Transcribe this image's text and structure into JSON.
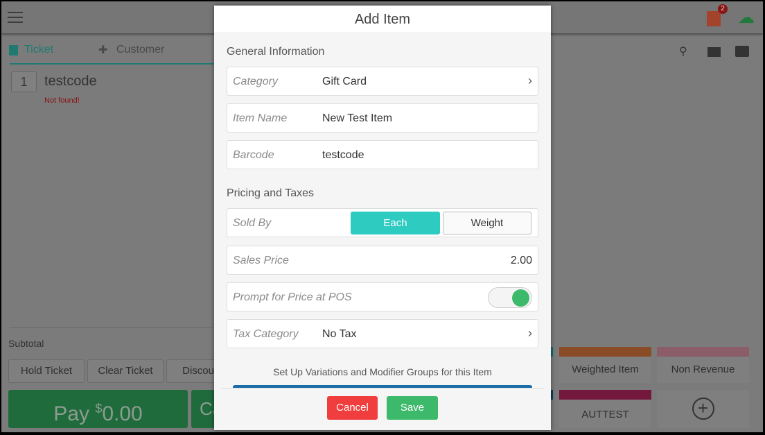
{
  "topbar": {
    "badge_count": "2"
  },
  "tabs": [
    {
      "label": "Ticket",
      "active": true
    },
    {
      "label": "Customer"
    }
  ],
  "ticket": {
    "qty": "1",
    "item": "testcode",
    "error": "Not found!"
  },
  "bottom": {
    "subtotal": "Subtotal",
    "hold": "Hold Ticket",
    "clear": "Clear Ticket",
    "discount": "Discou",
    "pay": "Pay",
    "pay_currency": "$",
    "pay_amount": "0.00",
    "partial": "Ca"
  },
  "tiles": [
    {
      "label": "Weighted Item",
      "color": "#8a4c27"
    },
    {
      "label": "Non Revenue",
      "color": "#8b5d69"
    },
    {
      "label": "AUTTEST",
      "color": "#74183e"
    }
  ],
  "modal": {
    "title": "Add Item",
    "general_header": "General Information",
    "category": {
      "label": "Category",
      "value": "Gift Card"
    },
    "item_name": {
      "label": "Item Name",
      "value": "New Test Item"
    },
    "barcode": {
      "label": "Barcode",
      "value": "testcode"
    },
    "pricing_header": "Pricing and Taxes",
    "sold_by": {
      "label": "Sold By",
      "options": [
        "Each",
        "Weight"
      ],
      "selected": "Each"
    },
    "sales_price": {
      "label": "Sales Price",
      "value": "2.00"
    },
    "prompt_price": {
      "label": "Prompt for Price at POS",
      "on": true
    },
    "tax_category": {
      "label": "Tax Category",
      "value": "No Tax"
    },
    "variations_text": "Set Up Variations and Modifier Groups for this Item",
    "cancel": "Cancel",
    "save": "Save"
  },
  "colors": {
    "accent": "#2ecbc1",
    "save": "#3cb96a",
    "cancel": "#f03d3d",
    "pay": "#1f6b3c"
  }
}
